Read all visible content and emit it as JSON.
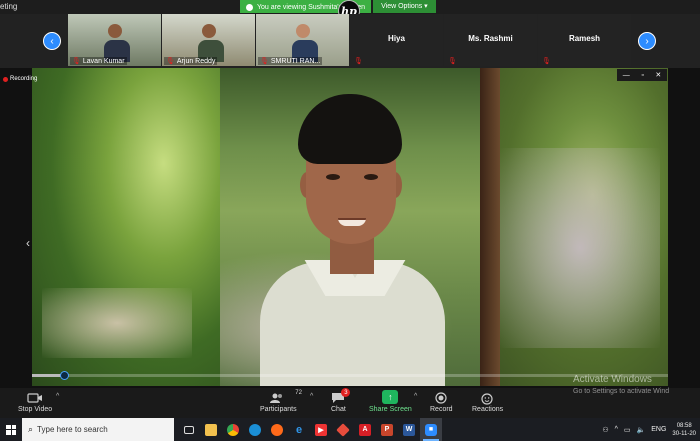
{
  "window": {
    "title_fragment": "eting"
  },
  "share_banner": {
    "text": "You are viewing Sushmita's screen",
    "view_options": "View Options"
  },
  "hp_logo": "hp",
  "gallery": {
    "tiles": [
      {
        "name": "Lavan Kumar",
        "type": "video"
      },
      {
        "name": "Arjun Reddy",
        "type": "video"
      },
      {
        "name": "SMRUTI RAN...",
        "type": "video"
      },
      {
        "name": "Hiya",
        "type": "name"
      },
      {
        "name": "Ms. Rashmi",
        "type": "name"
      },
      {
        "name": "Ramesh",
        "type": "name"
      }
    ]
  },
  "main": {
    "recording_label": "Recording",
    "popout": {
      "minimize": "—",
      "restore": "▫",
      "close": "✕"
    }
  },
  "toolbar": {
    "stop_video": "Stop Video",
    "participants": "Participants",
    "participants_count": "72",
    "chat": "Chat",
    "chat_badge": "3",
    "share_screen": "Share Screen",
    "record": "Record",
    "reactions": "Reactions"
  },
  "watermark": {
    "line1": "Activate Windows",
    "line2": "Go to Settings to activate Wind"
  },
  "taskbar": {
    "search_placeholder": "Type here to search",
    "lang": "ENG",
    "time": "08:58",
    "date": "30-11-20"
  },
  "colors": {
    "zoom_blue": "#2d8cff",
    "share_green": "#1fb55e",
    "banner_green": "#3cb043",
    "alert_red": "#e02020"
  }
}
